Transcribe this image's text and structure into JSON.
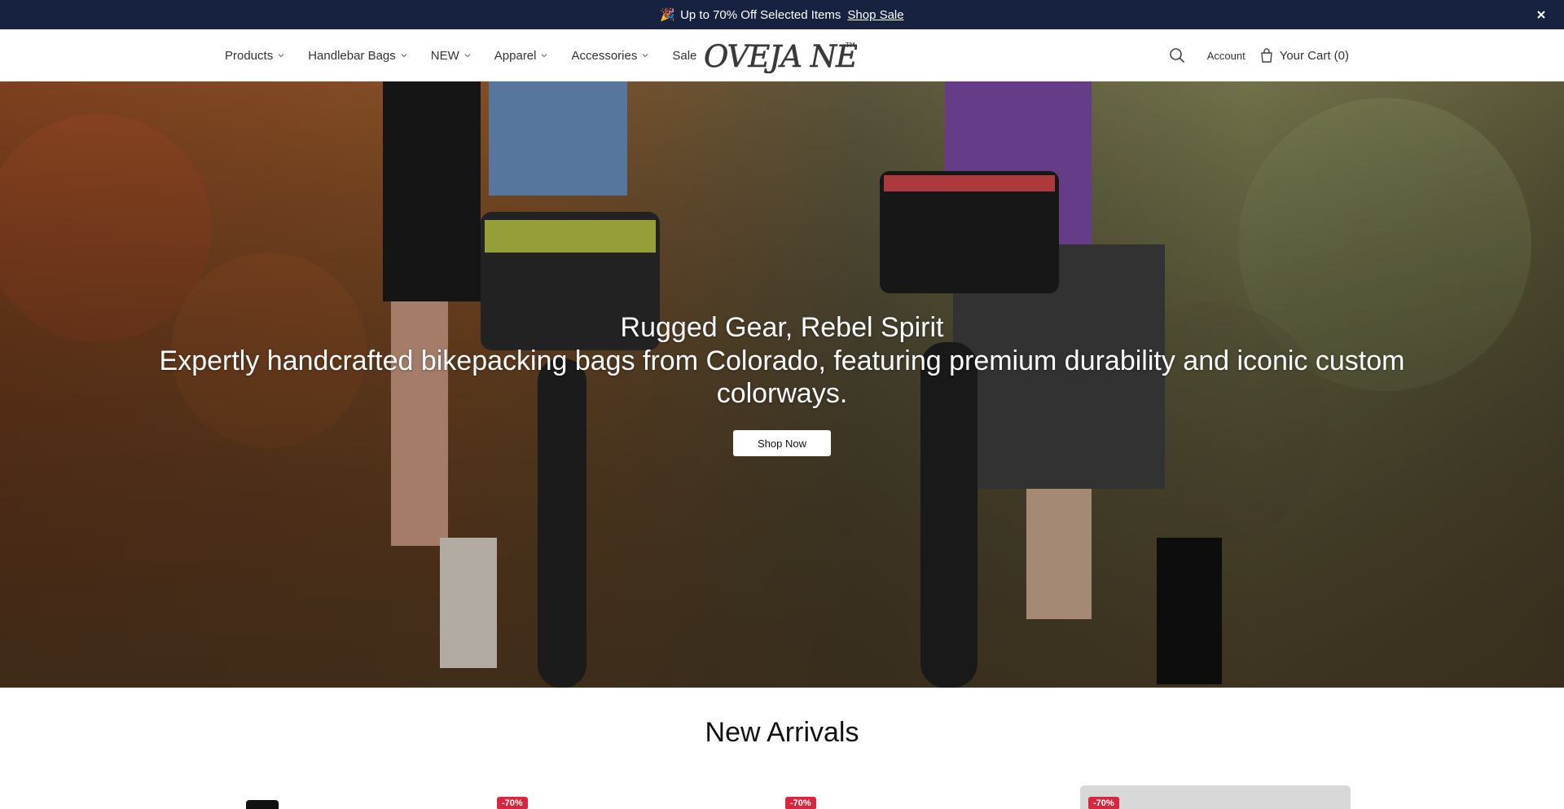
{
  "announcement": {
    "emoji": "🎉",
    "text": "Up to 70% Off Selected Items",
    "link": "Shop Sale"
  },
  "nav": {
    "items": [
      {
        "label": "Products",
        "dropdown": true
      },
      {
        "label": "Handlebar Bags",
        "dropdown": true
      },
      {
        "label": "NEW",
        "dropdown": true
      },
      {
        "label": "Apparel",
        "dropdown": true
      },
      {
        "label": "Accessories",
        "dropdown": true
      },
      {
        "label": "Sale",
        "dropdown": false
      }
    ]
  },
  "brand": {
    "logo_text": "OVEJA NEGRA",
    "trademark": "TM"
  },
  "header": {
    "account_label": "Account",
    "cart_label": "Your Cart (0)"
  },
  "hero": {
    "title": "Rugged Gear, Rebel Spirit",
    "subtitle": "Expertly handcrafted bikepacking bags from Colorado, featuring premium durability and iconic custom colorways.",
    "cta": "Shop Now"
  },
  "arrivals": {
    "title": "New Arrivals",
    "badges": [
      "-70%",
      "-70%",
      "-70%"
    ]
  },
  "colors": {
    "announce_bg": "#16223f",
    "badge": "#d7263d"
  }
}
